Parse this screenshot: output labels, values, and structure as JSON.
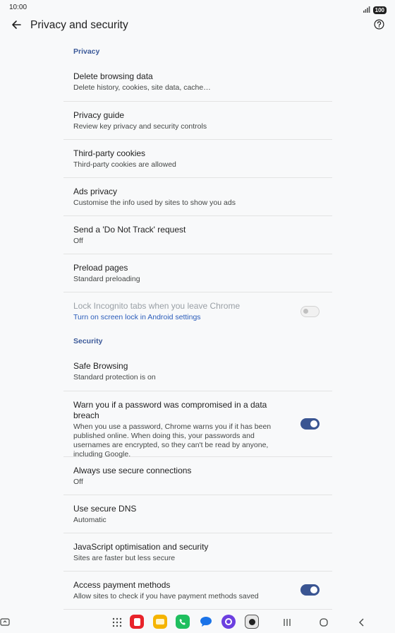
{
  "status": {
    "time": "10:00",
    "battery": "100"
  },
  "appbar": {
    "title": "Privacy and security"
  },
  "privacy": {
    "header": "Privacy",
    "items": [
      {
        "title": "Delete browsing data",
        "subtitle": "Delete history, cookies, site data, cache…"
      },
      {
        "title": "Privacy guide",
        "subtitle": "Review key privacy and security controls"
      },
      {
        "title": "Third-party cookies",
        "subtitle": "Third-party cookies are allowed"
      },
      {
        "title": "Ads privacy",
        "subtitle": "Customise the info used by sites to show you ads"
      },
      {
        "title": "Send a 'Do Not Track' request",
        "subtitle": "Off"
      },
      {
        "title": "Preload pages",
        "subtitle": "Standard preloading"
      },
      {
        "title": "Lock Incognito tabs when you leave Chrome",
        "subtitle": "Turn on screen lock in Android settings",
        "toggle": "off",
        "disabled": true
      }
    ]
  },
  "security": {
    "header": "Security",
    "items": [
      {
        "title": "Safe Browsing",
        "subtitle": "Standard protection is on"
      },
      {
        "title": "Warn you if a password was compromised in a data breach",
        "subtitle": "When you use a password, Chrome warns you if it has been published online. When doing this, your passwords and usernames are encrypted, so they can't be read by anyone, including Google.",
        "toggle": "on"
      },
      {
        "title": "Always use secure connections",
        "subtitle": "Off"
      },
      {
        "title": "Use secure DNS",
        "subtitle": "Automatic"
      },
      {
        "title": "JavaScript optimisation and security",
        "subtitle": "Sites are faster but less secure"
      },
      {
        "title": "Access payment methods",
        "subtitle": "Allow sites to check if you have payment methods saved",
        "toggle": "on"
      }
    ]
  },
  "colors": {
    "accent": "#3a5592",
    "section_header": "#3c5a99",
    "link": "#2a5cba",
    "background": "#f8f9fa"
  },
  "navbar": {
    "apps": [
      {
        "name": "app-drawer-icon",
        "color": "#444746"
      },
      {
        "name": "red-app-icon",
        "color": "#e8232a"
      },
      {
        "name": "notes-app-icon",
        "color": "#f5b400"
      },
      {
        "name": "phone-app-icon",
        "color": "#1fbf5f"
      },
      {
        "name": "messages-app-icon",
        "color": "#1a73e8"
      },
      {
        "name": "internet-app-icon",
        "color": "#6c3fe0"
      },
      {
        "name": "camera-app-icon",
        "color": "#555555"
      }
    ],
    "buttons": [
      "recents-button",
      "home-button",
      "back-nav-button"
    ]
  }
}
